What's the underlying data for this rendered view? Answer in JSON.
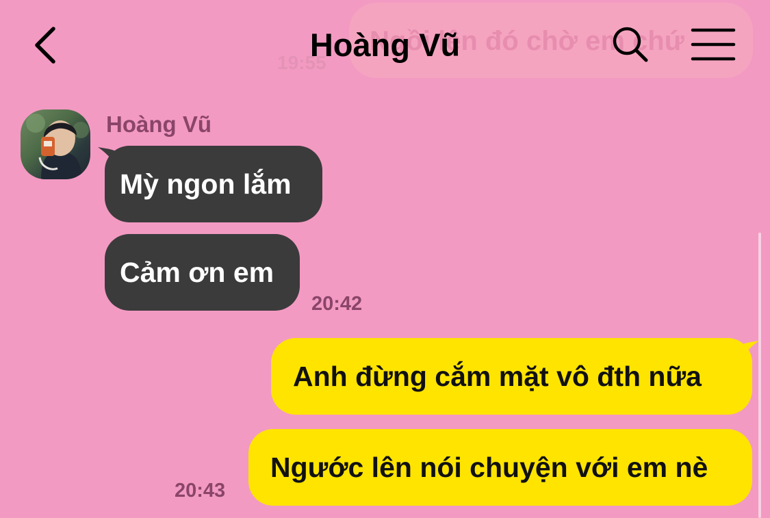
{
  "header": {
    "title": "Hoàng Vũ",
    "back_icon": "chevron-left-icon",
    "search_icon": "search-icon",
    "menu_icon": "hamburger-menu-icon"
  },
  "background_message": {
    "text": "Ngồi lên đó chờ em chứ",
    "time": "19:55"
  },
  "contact": {
    "name": "Hoàng Vũ"
  },
  "messages": [
    {
      "direction": "incoming",
      "text": "Mỳ ngon lắm"
    },
    {
      "direction": "incoming",
      "text": "Cảm ơn em",
      "time": "20:42"
    },
    {
      "direction": "outgoing",
      "text": "Anh đừng cắm mặt vô đth nữa"
    },
    {
      "direction": "outgoing",
      "text": "Ngước lên nói chuyện với em nè",
      "time": "20:43"
    }
  ],
  "colors": {
    "background": "#f39ac2",
    "incoming_bubble": "#3b3b3c",
    "outgoing_bubble": "#ffe400",
    "meta_text": "#8a4568"
  }
}
